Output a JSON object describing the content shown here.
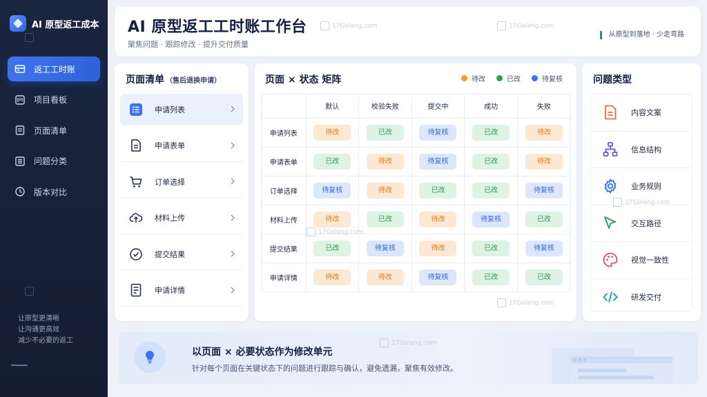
{
  "app": {
    "brand_title": "AI 原型返工成本"
  },
  "sidebar": {
    "items": [
      {
        "label": "返工工时账",
        "icon": "card-icon",
        "active": true
      },
      {
        "label": "项目看板",
        "icon": "kanban-icon",
        "active": false
      },
      {
        "label": "页面清单",
        "icon": "doc-list-icon",
        "active": false
      },
      {
        "label": "问题分类",
        "icon": "category-icon",
        "active": false
      },
      {
        "label": "版本对比",
        "icon": "clock-icon",
        "active": false
      }
    ],
    "footer_lines": [
      "让原型更清晰",
      "让沟通更高效",
      "减少不必要的返工"
    ]
  },
  "header": {
    "title": "AI 原型返工工时账工作台",
    "subtitle": "聚焦问题 · 跟踪修改 · 提升交付质量",
    "slogan": "从原型到落地 · 少走弯路"
  },
  "page_list": {
    "title": "页面清单",
    "title_note": "（售后退换申请）",
    "items": [
      {
        "label": "申请列表",
        "icon": "list-icon",
        "active": true
      },
      {
        "label": "申请表单",
        "icon": "form-icon",
        "active": false
      },
      {
        "label": "订单选择",
        "icon": "cart-icon",
        "active": false
      },
      {
        "label": "材料上传",
        "icon": "cloud-upload-icon",
        "active": false
      },
      {
        "label": "提交结果",
        "icon": "check-circle-icon",
        "active": false
      },
      {
        "label": "申请详情",
        "icon": "detail-icon",
        "active": false
      }
    ]
  },
  "matrix": {
    "title": "页面 × 状态 矩阵",
    "legend": [
      {
        "label": "待改",
        "color": "#f59a2b"
      },
      {
        "label": "已改",
        "color": "#2fa052"
      },
      {
        "label": "待复核",
        "color": "#3a73e6"
      }
    ],
    "columns": [
      "默认",
      "校验失败",
      "提交中",
      "成功",
      "失败"
    ],
    "rows": [
      {
        "label": "申请列表",
        "cells": [
          "待改",
          "已改",
          "待复核",
          "已改",
          "待改"
        ]
      },
      {
        "label": "申请表单",
        "cells": [
          "已改",
          "待改",
          "待复核",
          "已改",
          "待改"
        ]
      },
      {
        "label": "订单选择",
        "cells": [
          "待复核",
          "待改",
          "已改",
          "已改",
          "待复核"
        ]
      },
      {
        "label": "材料上传",
        "cells": [
          "待改",
          "已改",
          "待改",
          "待复核",
          "已改"
        ]
      },
      {
        "label": "提交结果",
        "cells": [
          "已改",
          "待复核",
          "待改",
          "已改",
          "待复核"
        ]
      },
      {
        "label": "申请详情",
        "cells": [
          "待改",
          "待改",
          "待复核",
          "已改",
          "已改"
        ]
      }
    ]
  },
  "issue_types": {
    "title": "问题类型",
    "items": [
      {
        "label": "内容文案",
        "icon": "document-icon",
        "color": "#ee6a3c"
      },
      {
        "label": "信息结构",
        "icon": "hierarchy-icon",
        "color": "#6a57d6"
      },
      {
        "label": "业务规则",
        "icon": "gear-icon",
        "color": "#2d6fe0"
      },
      {
        "label": "交互路径",
        "icon": "cursor-icon",
        "color": "#2aa05a"
      },
      {
        "label": "视觉一致性",
        "icon": "palette-icon",
        "color": "#e0457a"
      },
      {
        "label": "研发交付",
        "icon": "code-icon",
        "color": "#1fa6a0"
      }
    ]
  },
  "banner": {
    "title": "以页面 × 必要状态作为修改单元",
    "text": "针对每个页面在关键状态下的问题进行跟踪与确认，避免遗漏，聚焦有效修改。"
  },
  "watermark": {
    "text": "17Golang.com"
  }
}
